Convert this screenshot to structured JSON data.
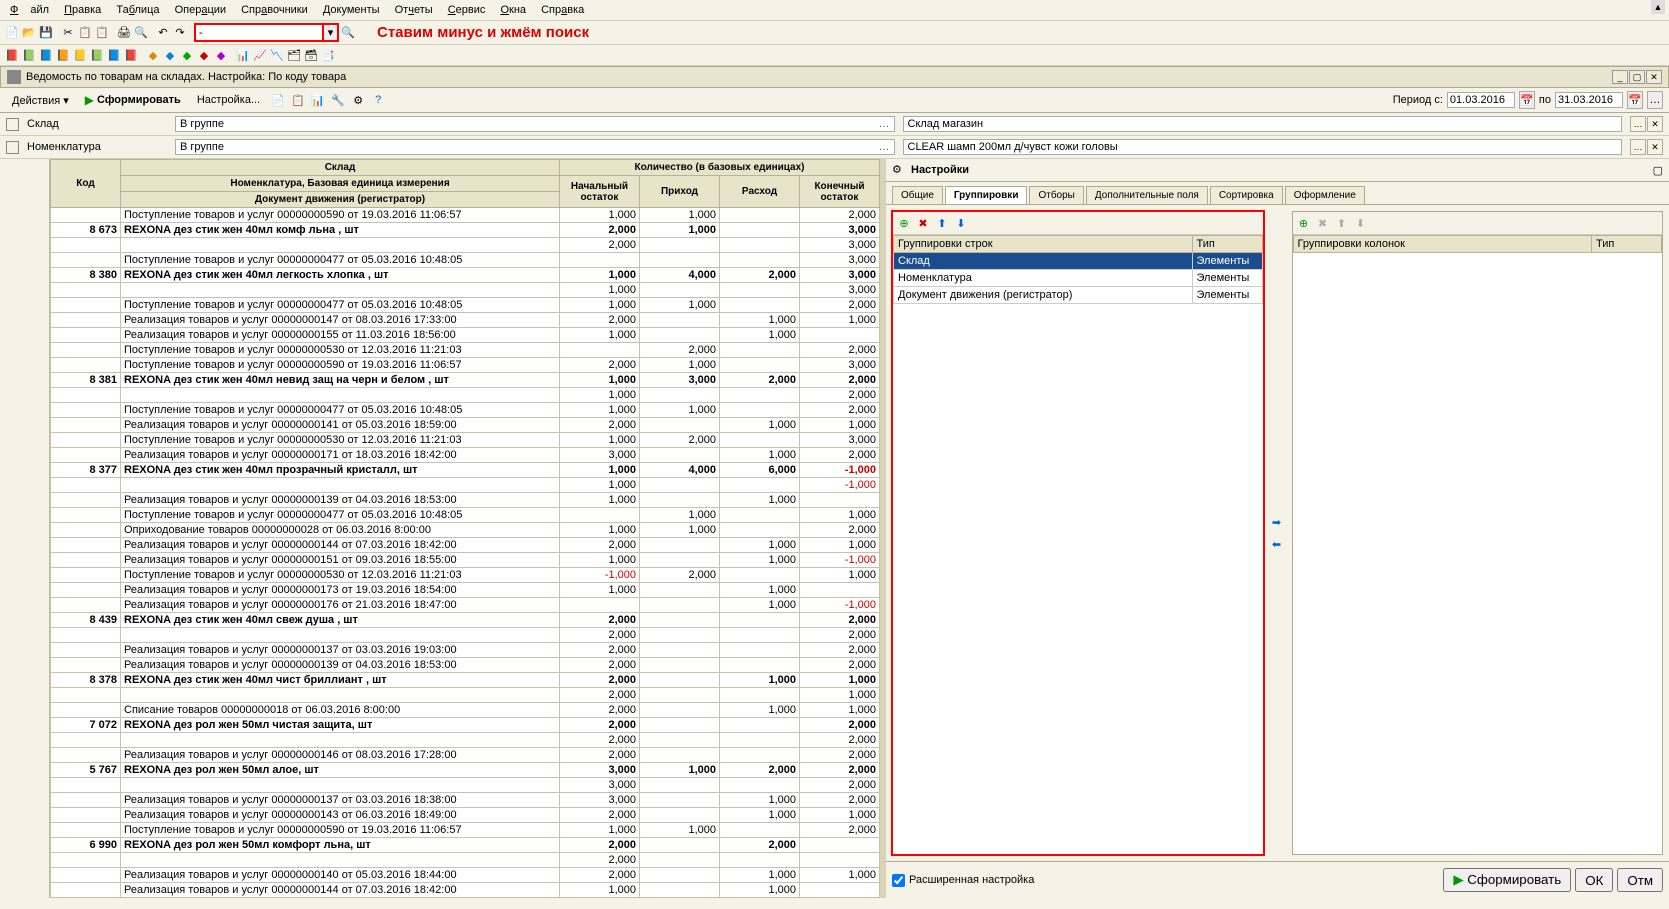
{
  "menu": [
    "Файл",
    "Правка",
    "Таблица",
    "Операции",
    "Справочники",
    "Документы",
    "Отчеты",
    "Сервис",
    "Окна",
    "Справка"
  ],
  "annotation": "Ставим минус и жмём поиск",
  "search_value": "-",
  "titlebar": "Ведомость по товарам на складах. Настройка: По коду товара",
  "actions_label": "Действия",
  "form_button": "Сформировать",
  "settings_button": "Настройка...",
  "period_label": "Период с:",
  "period_from": "01.03.2016",
  "period_to_label": "по",
  "period_to": "31.03.2016",
  "filters": {
    "store_label": "Склад",
    "store_combo": "В группе",
    "store_value": "Склад магазин",
    "nom_label": "Номенклатура",
    "nom_combo": "В группе",
    "nom_value": "CLEAR шамп 200мл д/чувст кожи головы"
  },
  "grid_headers": {
    "code": "Код",
    "store": "Склад",
    "qty": "Количество (в базовых единицах)",
    "nomen": "Номенклатура, Базовая единица измерения",
    "doc": "Документ движения (регистратор)",
    "start": "Начальный остаток",
    "in": "Приход",
    "out": "Расход",
    "end": "Конечный остаток"
  },
  "rows": [
    {
      "doc": "Поступление товаров и услуг 00000000590 от 19.03.2016 11:06:57",
      "s": "1,000",
      "i": "1,000",
      "o": "",
      "e": "2,000"
    },
    {
      "code": "8 673",
      "doc": "REXONA  дез стик жен 40мл комф льна , шт",
      "s": "2,000",
      "i": "1,000",
      "o": "",
      "e": "3,000",
      "bold": true
    },
    {
      "doc": "",
      "s": "2,000",
      "i": "",
      "o": "",
      "e": "3,000"
    },
    {
      "doc": "Поступление товаров и услуг 00000000477 от 05.03.2016 10:48:05",
      "s": "",
      "i": "",
      "o": "",
      "e": "3,000"
    },
    {
      "code": "8 380",
      "doc": "REXONA  дез стик жен 40мл легкость хлопка , шт",
      "s": "1,000",
      "i": "4,000",
      "o": "2,000",
      "e": "3,000",
      "bold": true
    },
    {
      "doc": "",
      "s": "1,000",
      "i": "",
      "o": "",
      "e": "3,000"
    },
    {
      "doc": "Поступление товаров и услуг 00000000477 от 05.03.2016 10:48:05",
      "s": "1,000",
      "i": "1,000",
      "o": "",
      "e": "2,000"
    },
    {
      "doc": "Реализация товаров и услуг 00000000147 от 08.03.2016 17:33:00",
      "s": "2,000",
      "i": "",
      "o": "1,000",
      "e": "1,000"
    },
    {
      "doc": "Реализация товаров и услуг 00000000155 от 11.03.2016 18:56:00",
      "s": "1,000",
      "i": "",
      "o": "1,000",
      "e": ""
    },
    {
      "doc": "Поступление товаров и услуг 00000000530 от 12.03.2016 11:21:03",
      "s": "",
      "i": "2,000",
      "o": "",
      "e": "2,000"
    },
    {
      "doc": "Поступление товаров и услуг 00000000590 от 19.03.2016 11:06:57",
      "s": "2,000",
      "i": "1,000",
      "o": "",
      "e": "3,000"
    },
    {
      "code": "8 381",
      "doc": "REXONA  дез стик жен 40мл невид защ на черн и белом , шт",
      "s": "1,000",
      "i": "3,000",
      "o": "2,000",
      "e": "2,000",
      "bold": true
    },
    {
      "doc": "",
      "s": "1,000",
      "i": "",
      "o": "",
      "e": "2,000"
    },
    {
      "doc": "Поступление товаров и услуг 00000000477 от 05.03.2016 10:48:05",
      "s": "1,000",
      "i": "1,000",
      "o": "",
      "e": "2,000"
    },
    {
      "doc": "Реализация товаров и услуг 00000000141 от 05.03.2016 18:59:00",
      "s": "2,000",
      "i": "",
      "o": "1,000",
      "e": "1,000"
    },
    {
      "doc": "Поступление товаров и услуг 00000000530 от 12.03.2016 11:21:03",
      "s": "1,000",
      "i": "2,000",
      "o": "",
      "e": "3,000"
    },
    {
      "doc": "Реализация товаров и услуг 00000000171 от 18.03.2016 18:42:00",
      "s": "3,000",
      "i": "",
      "o": "1,000",
      "e": "2,000"
    },
    {
      "code": "8 377",
      "doc": "REXONA  дез стик жен 40мл прозрачный кристалл, шт",
      "s": "1,000",
      "i": "4,000",
      "o": "6,000",
      "e": "-1,000",
      "bold": true,
      "neg": true
    },
    {
      "doc": "",
      "s": "1,000",
      "i": "",
      "o": "",
      "e": "-1,000",
      "neg": true
    },
    {
      "doc": "Реализация товаров и услуг 00000000139 от 04.03.2016 18:53:00",
      "s": "1,000",
      "i": "",
      "o": "1,000",
      "e": ""
    },
    {
      "doc": "Поступление товаров и услуг 00000000477 от 05.03.2016 10:48:05",
      "s": "",
      "i": "1,000",
      "o": "",
      "e": "1,000"
    },
    {
      "doc": "Оприходование товаров 00000000028 от 06.03.2016 8:00:00",
      "s": "1,000",
      "i": "1,000",
      "o": "",
      "e": "2,000"
    },
    {
      "doc": "Реализация товаров и услуг 00000000144 от 07.03.2016 18:42:00",
      "s": "2,000",
      "i": "",
      "o": "1,000",
      "e": "1,000"
    },
    {
      "doc": "Реализация товаров и услуг 00000000151 от 09.03.2016 18:55:00",
      "s": "1,000",
      "i": "",
      "o": "1,000",
      "e": "-1,000",
      "neg": true
    },
    {
      "doc": "Поступление товаров и услуг 00000000530 от 12.03.2016 11:21:03",
      "s": "-1,000",
      "i": "2,000",
      "o": "",
      "e": "1,000",
      "negs": true
    },
    {
      "doc": "Реализация товаров и услуг 00000000173 от 19.03.2016 18:54:00",
      "s": "1,000",
      "i": "",
      "o": "1,000",
      "e": ""
    },
    {
      "doc": "Реализация товаров и услуг 00000000176 от 21.03.2016 18:47:00",
      "s": "",
      "i": "",
      "o": "1,000",
      "e": "-1,000",
      "neg": true
    },
    {
      "code": "8 439",
      "doc": "REXONA  дез стик жен 40мл свеж душа , шт",
      "s": "2,000",
      "i": "",
      "o": "",
      "e": "2,000",
      "bold": true
    },
    {
      "doc": "",
      "s": "2,000",
      "i": "",
      "o": "",
      "e": "2,000"
    },
    {
      "doc": "Реализация товаров и услуг 00000000137 от 03.03.2016 19:03:00",
      "s": "2,000",
      "i": "",
      "o": "",
      "e": "2,000"
    },
    {
      "doc": "Реализация товаров и услуг 00000000139 от 04.03.2016 18:53:00",
      "s": "2,000",
      "i": "",
      "o": "",
      "e": "2,000"
    },
    {
      "code": "8 378",
      "doc": "REXONA  дез стик жен 40мл чист бриллиант , шт",
      "s": "2,000",
      "i": "",
      "o": "1,000",
      "e": "1,000",
      "bold": true
    },
    {
      "doc": "",
      "s": "2,000",
      "i": "",
      "o": "",
      "e": "1,000"
    },
    {
      "doc": "Списание товаров 00000000018 от 06.03.2016 8:00:00",
      "s": "2,000",
      "i": "",
      "o": "1,000",
      "e": "1,000"
    },
    {
      "code": "7 072",
      "doc": "REXONA дез рол жен  50мл чистая защита, шт",
      "s": "2,000",
      "i": "",
      "o": "",
      "e": "2,000",
      "bold": true
    },
    {
      "doc": "",
      "s": "2,000",
      "i": "",
      "o": "",
      "e": "2,000"
    },
    {
      "doc": "Реализация товаров и услуг 00000000146 от 08.03.2016 17:28:00",
      "s": "2,000",
      "i": "",
      "o": "",
      "e": "2,000"
    },
    {
      "code": "5 767",
      "doc": "REXONA дез рол жен 50мл алое, шт",
      "s": "3,000",
      "i": "1,000",
      "o": "2,000",
      "e": "2,000",
      "bold": true
    },
    {
      "doc": "",
      "s": "3,000",
      "i": "",
      "o": "",
      "e": "2,000"
    },
    {
      "doc": "Реализация товаров и услуг 00000000137 от 03.03.2016 18:38:00",
      "s": "3,000",
      "i": "",
      "o": "1,000",
      "e": "2,000"
    },
    {
      "doc": "Реализация товаров и услуг 00000000143 от 06.03.2016 18:49:00",
      "s": "2,000",
      "i": "",
      "o": "1,000",
      "e": "1,000"
    },
    {
      "doc": "Поступление товаров и услуг 00000000590 от 19.03.2016 11:06:57",
      "s": "1,000",
      "i": "1,000",
      "o": "",
      "e": "2,000"
    },
    {
      "code": "6 990",
      "doc": "REXONA дез рол жен 50мл комфорт льна, шт",
      "s": "2,000",
      "i": "",
      "o": "2,000",
      "e": "",
      "bold": true
    },
    {
      "doc": "",
      "s": "2,000",
      "i": "",
      "o": "",
      "e": ""
    },
    {
      "doc": "Реализация товаров и услуг 00000000140 от 05.03.2016 18:44:00",
      "s": "2,000",
      "i": "",
      "o": "1,000",
      "e": "1,000"
    },
    {
      "doc": "Реализация товаров и услуг 00000000144 от 07.03.2016 18:42:00",
      "s": "1,000",
      "i": "",
      "o": "1,000",
      "e": ""
    }
  ],
  "settings_panel": {
    "title": "Настройки",
    "tabs": [
      "Общие",
      "Группировки",
      "Отборы",
      "Дополнительные поля",
      "Сортировка",
      "Оформление"
    ],
    "active_tab": 1,
    "rows_header": "Группировки строк",
    "type_header": "Тип",
    "cols_header": "Группировки колонок",
    "rows": [
      {
        "name": "Склад",
        "type": "Элементы",
        "sel": true
      },
      {
        "name": "Номенклатура",
        "type": "Элементы"
      },
      {
        "name": "Документ движения (регистратор)",
        "type": "Элементы"
      }
    ],
    "ext_label": "Расширенная настройка",
    "form_btn": "Сформировать",
    "ok": "ОК",
    "cancel": "Отм"
  }
}
